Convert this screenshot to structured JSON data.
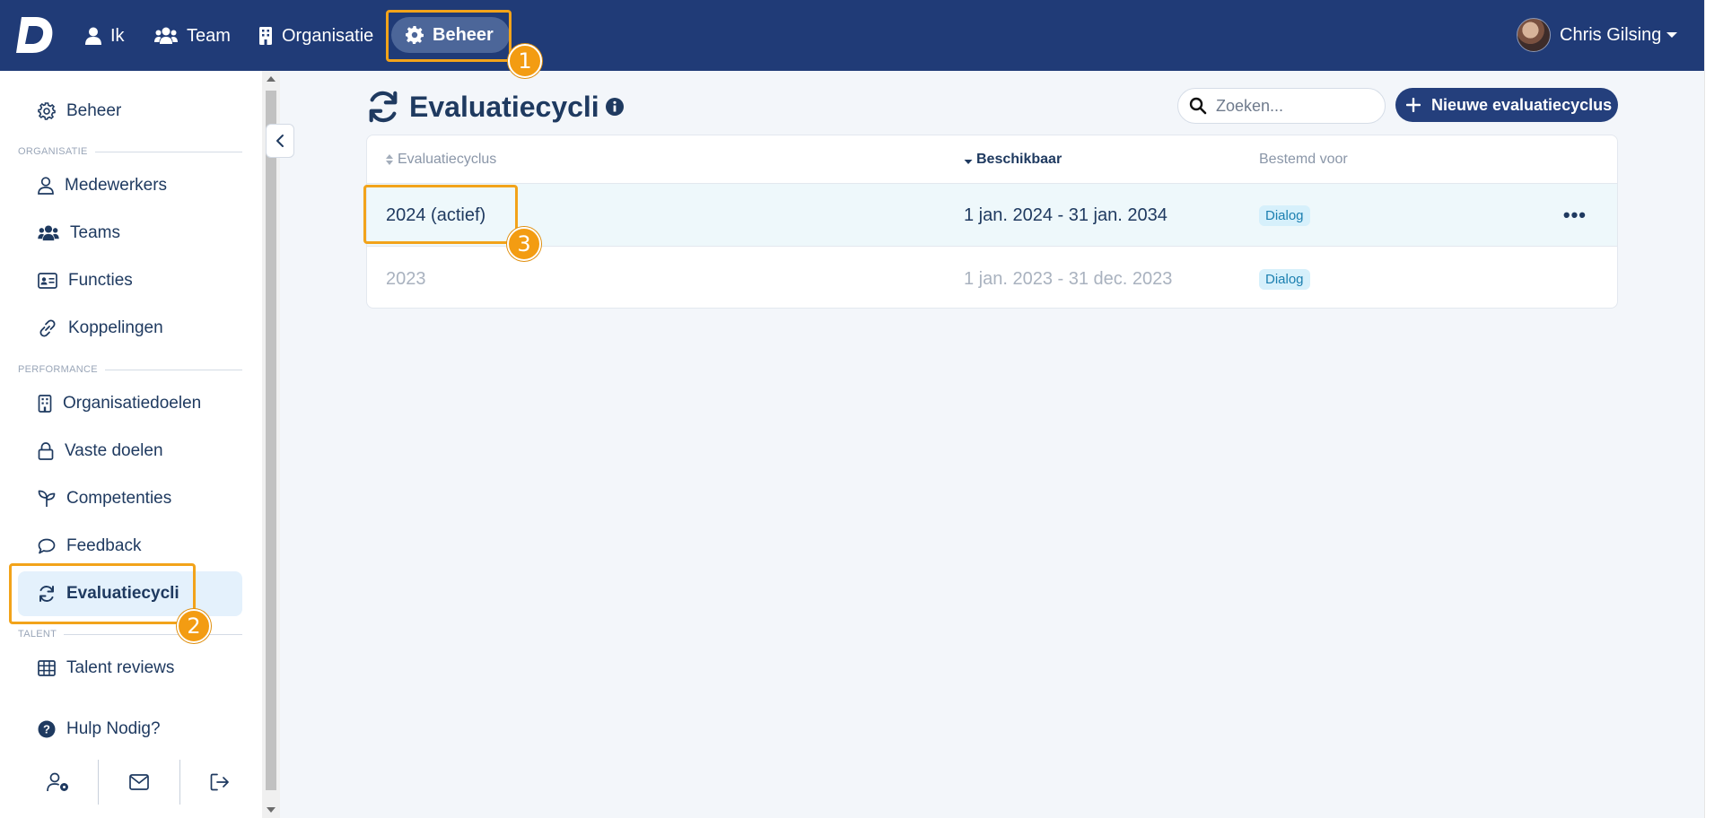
{
  "nav": {
    "items": [
      {
        "label": "Ik",
        "icon": "user-icon"
      },
      {
        "label": "Team",
        "icon": "users-icon"
      },
      {
        "label": "Organisatie",
        "icon": "building-icon"
      },
      {
        "label": "Beheer",
        "icon": "gear-icon",
        "active": true
      }
    ],
    "user_name": "Chris Gilsing"
  },
  "sidebar": {
    "top_item": "Beheer",
    "sections": {
      "organisatie": "ORGANISATIE",
      "performance": "PERFORMANCE",
      "talent": "TALENT"
    },
    "items": {
      "medewerkers": "Medewerkers",
      "teams": "Teams",
      "functies": "Functies",
      "koppelingen": "Koppelingen",
      "organisatiedoelen": "Organisatiedoelen",
      "vaste_doelen": "Vaste doelen",
      "competenties": "Competenties",
      "feedback": "Feedback",
      "evaluatiecycli": "Evaluatiecycli",
      "talent_reviews": "Talent reviews"
    },
    "help": "Hulp Nodig?"
  },
  "main": {
    "title": "Evaluatiecycli",
    "search_placeholder": "Zoeken...",
    "new_button": "Nieuwe evaluatiecyclus",
    "columns": {
      "cycle": "Evaluatiecyclus",
      "available": "Beschikbaar",
      "intended_for": "Bestemd voor"
    },
    "rows": [
      {
        "cycle": "2024  (actief)",
        "available": "1 jan. 2024 - 31 jan. 2034",
        "intended_for": "Dialog",
        "active": true
      },
      {
        "cycle": "2023",
        "available": "1 jan. 2023 - 31 dec. 2023",
        "intended_for": "Dialog",
        "active": false
      }
    ]
  },
  "annotations": [
    "1",
    "2",
    "3"
  ],
  "colors": {
    "topbar": "#203b77",
    "active_nav_pill": "#4c6699",
    "accent_button": "#243f7c",
    "highlight": "#f2a31a",
    "badge_bg": "#d6f0fb",
    "active_row_bg": "#eef8fb"
  }
}
